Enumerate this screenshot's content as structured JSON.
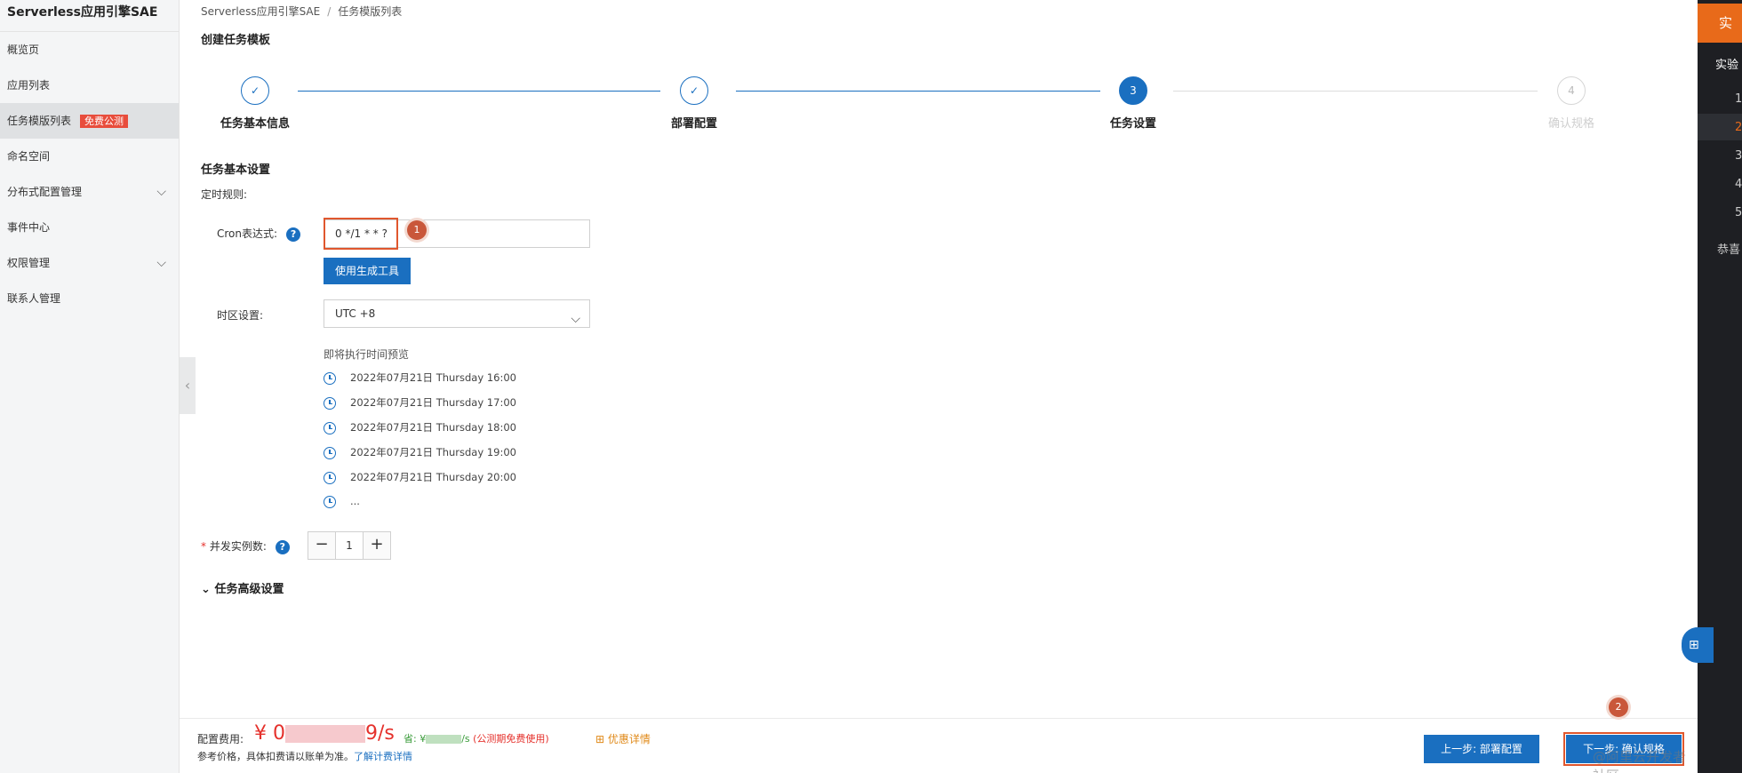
{
  "sidebar": {
    "title": "Serverless应用引擎SAE",
    "items": [
      {
        "label": "概览页"
      },
      {
        "label": "应用列表"
      },
      {
        "label": "任务模版列表",
        "badge": "免费公测"
      },
      {
        "label": "命名空间"
      },
      {
        "label": "分布式配置管理"
      },
      {
        "label": "事件中心"
      },
      {
        "label": "权限管理"
      },
      {
        "label": "联系人管理"
      }
    ]
  },
  "breadcrumb": [
    "Serverless应用引擎SAE",
    "/",
    "任务模版列表"
  ],
  "page_title": "创建任务模板",
  "steps": [
    {
      "number": "✓",
      "label": "任务基本信息"
    },
    {
      "number": "✓",
      "label": "部署配置"
    },
    {
      "number": "3",
      "label": "任务设置"
    },
    {
      "number": "4",
      "label": "确认规格"
    }
  ],
  "form": {
    "section_title": "任务基本设置",
    "timing_rule": "定时规则:",
    "cron_label": "Cron表达式:",
    "cron_value": "0 */1 * * ?",
    "generator_button": "使用生成工具",
    "timezone_label": "时区设置:",
    "timezone_value": "UTC +8",
    "preview_title": "即将执行时间预览",
    "preview_times": [
      "2022年07月21日 Thursday 16:00",
      "2022年07月21日 Thursday 17:00",
      "2022年07月21日 Thursday 18:00",
      "2022年07月21日 Thursday 19:00",
      "2022年07月21日 Thursday 20:00",
      "..."
    ],
    "required_mark": "*",
    "concurrency_label": "并发实例数:",
    "concurrency_value": "1",
    "minus": "−",
    "plus": "+",
    "advanced_label": "任务高级设置",
    "help_glyph": "?"
  },
  "markers": {
    "one": "1",
    "two": "2"
  },
  "footer": {
    "fee_label": "配置费用:",
    "fee_prefix": "¥ 0",
    "fee_suffix": "9/s",
    "save_prefix": "省: ¥",
    "save_suffix": "/s",
    "save_note": "(公测期免费使用)",
    "promo": "优惠详情",
    "ref_text": "参考价格，具体扣费请以账单为准。",
    "ref_link": "了解计费详情",
    "prev_button": "上一步: 部署配置",
    "next_button": "下一步: 确认规格",
    "watermark": "@阿里云开发者社区"
  },
  "right_panel": {
    "tab": "实验",
    "heading": "实验",
    "numbers": [
      "1",
      "2",
      "3",
      "4",
      "5"
    ],
    "bottom": "恭喜"
  },
  "colors": {
    "primary": "#1a6fc0",
    "accent": "#e86a1a",
    "danger": "#e5312c",
    "annotation": "#e0572e"
  }
}
